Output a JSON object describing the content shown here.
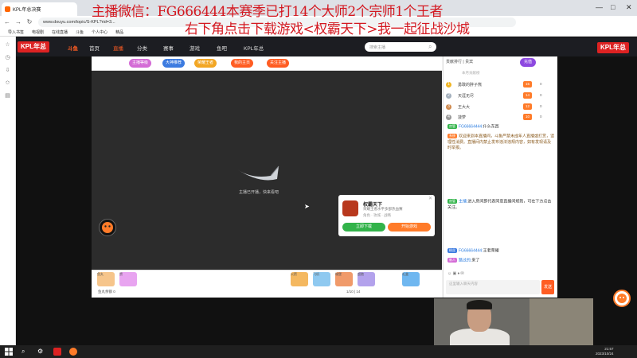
{
  "browser": {
    "tab_title": "KPL年总决赛",
    "url": "www.douyu.com/topic/S-KPL?rid=3...",
    "bookmarks": [
      "导入书签",
      "电视剧",
      "在线直播",
      "斗鱼",
      "个人中心",
      "精品"
    ]
  },
  "site": {
    "logo": "KPL年总",
    "brand": "斗鱼",
    "nav": [
      "首页",
      "直播",
      "分类",
      "赛事",
      "游戏",
      "鱼吧",
      "KPL年总"
    ],
    "search_placeholder": "搜索主播"
  },
  "room": {
    "pills": [
      "主播等级",
      "大神推荐",
      "荣耀王者",
      "我的主页",
      "关注主播"
    ],
    "loading_text": "主播已开播，快来看吧"
  },
  "game_popup": {
    "title": "权霸天下",
    "desc": "荣耀王者水平多部热血赛",
    "meta": "角色 · 攻城 · 战略",
    "btn_download": "立即下载",
    "btn_play": "开始游戏"
  },
  "gifts": {
    "fish_text": "鱼丸余额 0",
    "pages": "1/10  |  14",
    "items": [
      "鱼丸",
      "赞",
      "火箭",
      "飞机",
      "城堡",
      "超跑",
      "礼盒"
    ]
  },
  "chat": {
    "top": "贡献排行 | 贵宾",
    "recharge": "充值",
    "rank_note": "本月贡献榜",
    "ranks": [
      {
        "num": "1",
        "name": "勇敢的胖子熊",
        "badge": "15",
        "count": "0"
      },
      {
        "num": "2",
        "name": "天涯无尽",
        "badge": "14",
        "count": "0"
      },
      {
        "num": "3",
        "name": "王大大",
        "badge": "12",
        "count": "0"
      },
      {
        "num": "4",
        "name": "菠萝",
        "badge": "10",
        "count": "0"
      }
    ],
    "messages": [
      {
        "tag": "房管",
        "who": "FG66664444:",
        "text": "什么东西"
      },
      {
        "tag": "系统",
        "who": "",
        "text": "欢迎来到本直播间，斗鱼严禁未成年人直播或打赏，请理性消费。直播间内禁止发布违法违规内容，如有发现请及时举报。"
      },
      {
        "tag": "房管",
        "who": "主播:",
        "text": "进入房间即代表同意直播间规则，可在下方点击关注。"
      },
      {
        "tag": "粉丝",
        "who": "FG66664444:",
        "text": "王者荣耀"
      },
      {
        "tag": "新人",
        "who": "路过的:",
        "text": "来了"
      }
    ],
    "input_placeholder": "这里输入聊天内容",
    "send": "发送",
    "tools": "☺  ▣  ♦  ✉"
  },
  "overlay": {
    "line1": "主播微信：FG666444本赛季已打14个大师2个宗师1个王者",
    "line2": "右下角点击下载游戏<权霸天下>我一起征战沙城"
  },
  "taskbar": {
    "time": "21:57",
    "date": "2023/10/24"
  },
  "colors": {
    "brand_orange": "#ff5d23",
    "overlay_red": "#d41820",
    "header_dark": "#1c1d22"
  }
}
